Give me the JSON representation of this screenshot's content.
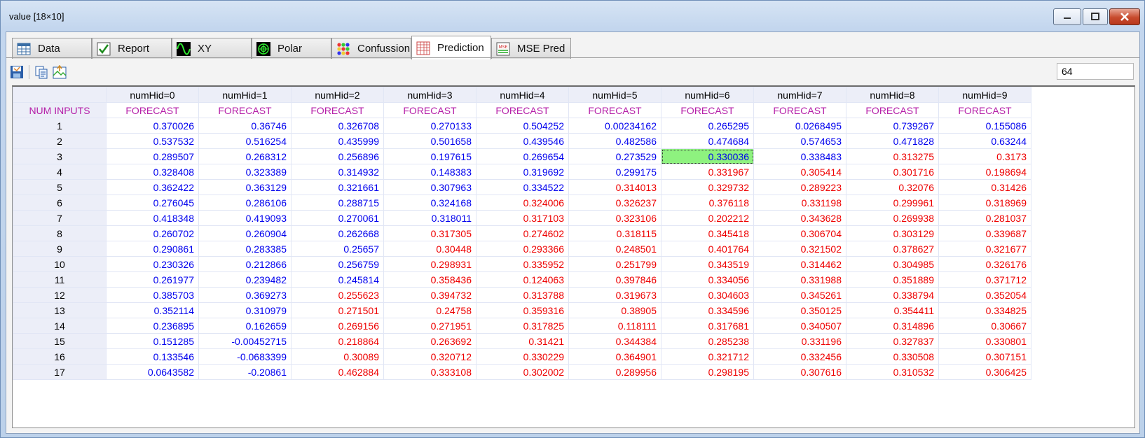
{
  "window": {
    "title": "value [18×10]"
  },
  "tabs": [
    {
      "label": "Data",
      "icon": "table-icon"
    },
    {
      "label": "Report",
      "icon": "checkmark-icon"
    },
    {
      "label": "XY",
      "icon": "wave-icon"
    },
    {
      "label": "Polar",
      "icon": "polar-icon"
    },
    {
      "label": "Confussion",
      "icon": "dots-icon"
    },
    {
      "label": "Prediction",
      "icon": "grid-icon",
      "active": true
    },
    {
      "label": "MSE Pred",
      "icon": "mse-icon"
    }
  ],
  "toolbar": {
    "buttons": [
      "save-icon",
      "copy-icon",
      "export-icon"
    ],
    "value": "64"
  },
  "grid": {
    "corner_header": "",
    "row_label_header": "NUM INPUTS",
    "columns": [
      "numHid=0",
      "numHid=1",
      "numHid=2",
      "numHid=3",
      "numHid=4",
      "numHid=5",
      "numHid=6",
      "numHid=7",
      "numHid=8",
      "numHid=9"
    ],
    "subheader": "FORECAST",
    "selected": {
      "row": 2,
      "col": 6
    },
    "colors": {
      "blue": "#0000ee",
      "red": "#ee0000",
      "purple": "#b51ea8",
      "selected": "#8ef27f"
    },
    "rows": [
      {
        "label": "1",
        "values": [
          "0.370026",
          "0.36746",
          "0.326708",
          "0.270133",
          "0.504252",
          "0.00234162",
          "0.265295",
          "0.0268495",
          "0.739267",
          "0.155086"
        ],
        "red_from": 10
      },
      {
        "label": "2",
        "values": [
          "0.537532",
          "0.516254",
          "0.435999",
          "0.501658",
          "0.439546",
          "0.482586",
          "0.474684",
          "0.574653",
          "0.471828",
          "0.63244"
        ],
        "red_from": 10
      },
      {
        "label": "3",
        "values": [
          "0.289507",
          "0.268312",
          "0.256896",
          "0.197615",
          "0.269654",
          "0.273529",
          "0.330036",
          "0.338483",
          "0.313275",
          "0.3173"
        ],
        "red_from": 8
      },
      {
        "label": "4",
        "values": [
          "0.328408",
          "0.323389",
          "0.314932",
          "0.148383",
          "0.319692",
          "0.299175",
          "0.331967",
          "0.305414",
          "0.301716",
          "0.198694"
        ],
        "red_from": 6
      },
      {
        "label": "5",
        "values": [
          "0.362422",
          "0.363129",
          "0.321661",
          "0.307963",
          "0.334522",
          "0.314013",
          "0.329732",
          "0.289223",
          "0.32076",
          "0.31426"
        ],
        "red_from": 5
      },
      {
        "label": "6",
        "values": [
          "0.276045",
          "0.286106",
          "0.288715",
          "0.324168",
          "0.324006",
          "0.326237",
          "0.376118",
          "0.331198",
          "0.299961",
          "0.318969"
        ],
        "red_from": 4
      },
      {
        "label": "7",
        "values": [
          "0.418348",
          "0.419093",
          "0.270061",
          "0.318011",
          "0.317103",
          "0.323106",
          "0.202212",
          "0.343628",
          "0.269938",
          "0.281037"
        ],
        "red_from": 4
      },
      {
        "label": "8",
        "values": [
          "0.260702",
          "0.260904",
          "0.262668",
          "0.317305",
          "0.274602",
          "0.318115",
          "0.345418",
          "0.306704",
          "0.303129",
          "0.339687"
        ],
        "red_from": 3
      },
      {
        "label": "9",
        "values": [
          "0.290861",
          "0.283385",
          "0.25657",
          "0.30448",
          "0.293366",
          "0.248501",
          "0.401764",
          "0.321502",
          "0.378627",
          "0.321677"
        ],
        "red_from": 3
      },
      {
        "label": "10",
        "values": [
          "0.230326",
          "0.212866",
          "0.256759",
          "0.298931",
          "0.335952",
          "0.251799",
          "0.343519",
          "0.314462",
          "0.304985",
          "0.326176"
        ],
        "red_from": 3
      },
      {
        "label": "11",
        "values": [
          "0.261977",
          "0.239482",
          "0.245814",
          "0.358436",
          "0.124063",
          "0.397846",
          "0.334056",
          "0.331988",
          "0.351889",
          "0.371712"
        ],
        "red_from": 3
      },
      {
        "label": "12",
        "values": [
          "0.385703",
          "0.369273",
          "0.255623",
          "0.394732",
          "0.313788",
          "0.319673",
          "0.304603",
          "0.345261",
          "0.338794",
          "0.352054"
        ],
        "red_from": 2
      },
      {
        "label": "13",
        "values": [
          "0.352114",
          "0.310979",
          "0.271501",
          "0.24758",
          "0.359316",
          "0.38905",
          "0.334596",
          "0.350125",
          "0.354411",
          "0.334825"
        ],
        "red_from": 2
      },
      {
        "label": "14",
        "values": [
          "0.236895",
          "0.162659",
          "0.269156",
          "0.271951",
          "0.317825",
          "0.118111",
          "0.317681",
          "0.340507",
          "0.314896",
          "0.30667"
        ],
        "red_from": 2
      },
      {
        "label": "15",
        "values": [
          "0.151285",
          "-0.00452715",
          "0.218864",
          "0.263692",
          "0.31421",
          "0.344384",
          "0.285238",
          "0.331196",
          "0.327837",
          "0.330801"
        ],
        "red_from": 2
      },
      {
        "label": "16",
        "values": [
          "0.133546",
          "-0.0683399",
          "0.30089",
          "0.320712",
          "0.330229",
          "0.364901",
          "0.321712",
          "0.332456",
          "0.330508",
          "0.307151"
        ],
        "red_from": 2
      },
      {
        "label": "17",
        "values": [
          "0.0643582",
          "-0.20861",
          "0.462884",
          "0.333108",
          "0.302002",
          "0.289956",
          "0.298195",
          "0.307616",
          "0.310532",
          "0.306425"
        ],
        "red_from": 2
      }
    ]
  }
}
